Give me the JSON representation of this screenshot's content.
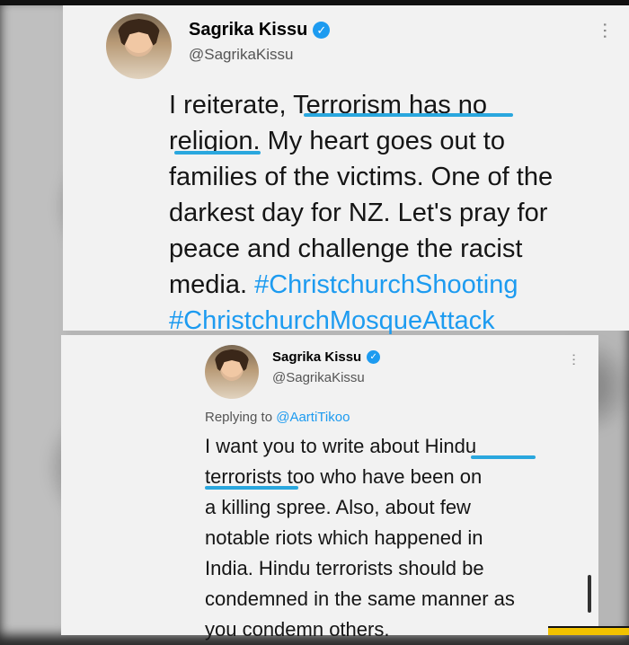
{
  "tweet_top": {
    "name": "Sagrika Kissu",
    "handle": "@SagrikaKissu",
    "text_lines": [
      "I reiterate, Terrorism has no",
      "religion. My heart goes out to",
      "families of the victims. One of the",
      "darkest day for NZ.  Let's pray for",
      "peace and challenge the racist",
      "media. #ChristchurchShooting",
      "#ChristchurchMosqueAttack"
    ],
    "icons": {
      "verified": "verified-badge-icon",
      "more": "more-options-icon"
    }
  },
  "tweet_bottom": {
    "name": "Sagrika Kissu",
    "handle": "@SagrikaKissu",
    "reply_prefix": "Replying to ",
    "reply_target": "@AartiTikoo",
    "text_lines": [
      "I want you to write about Hindu",
      "terrorists too who have been on",
      "a killing spree. Also, about few",
      "notable riots which happened in",
      "India. Hindu terrorists should be",
      "condemned in the same manner as",
      "you condemn others."
    ],
    "icons": {
      "verified": "verified-badge-icon",
      "more": "more-options-icon"
    }
  },
  "colors": {
    "accent": "#1d9bf0",
    "underline": "#2aa7de"
  }
}
